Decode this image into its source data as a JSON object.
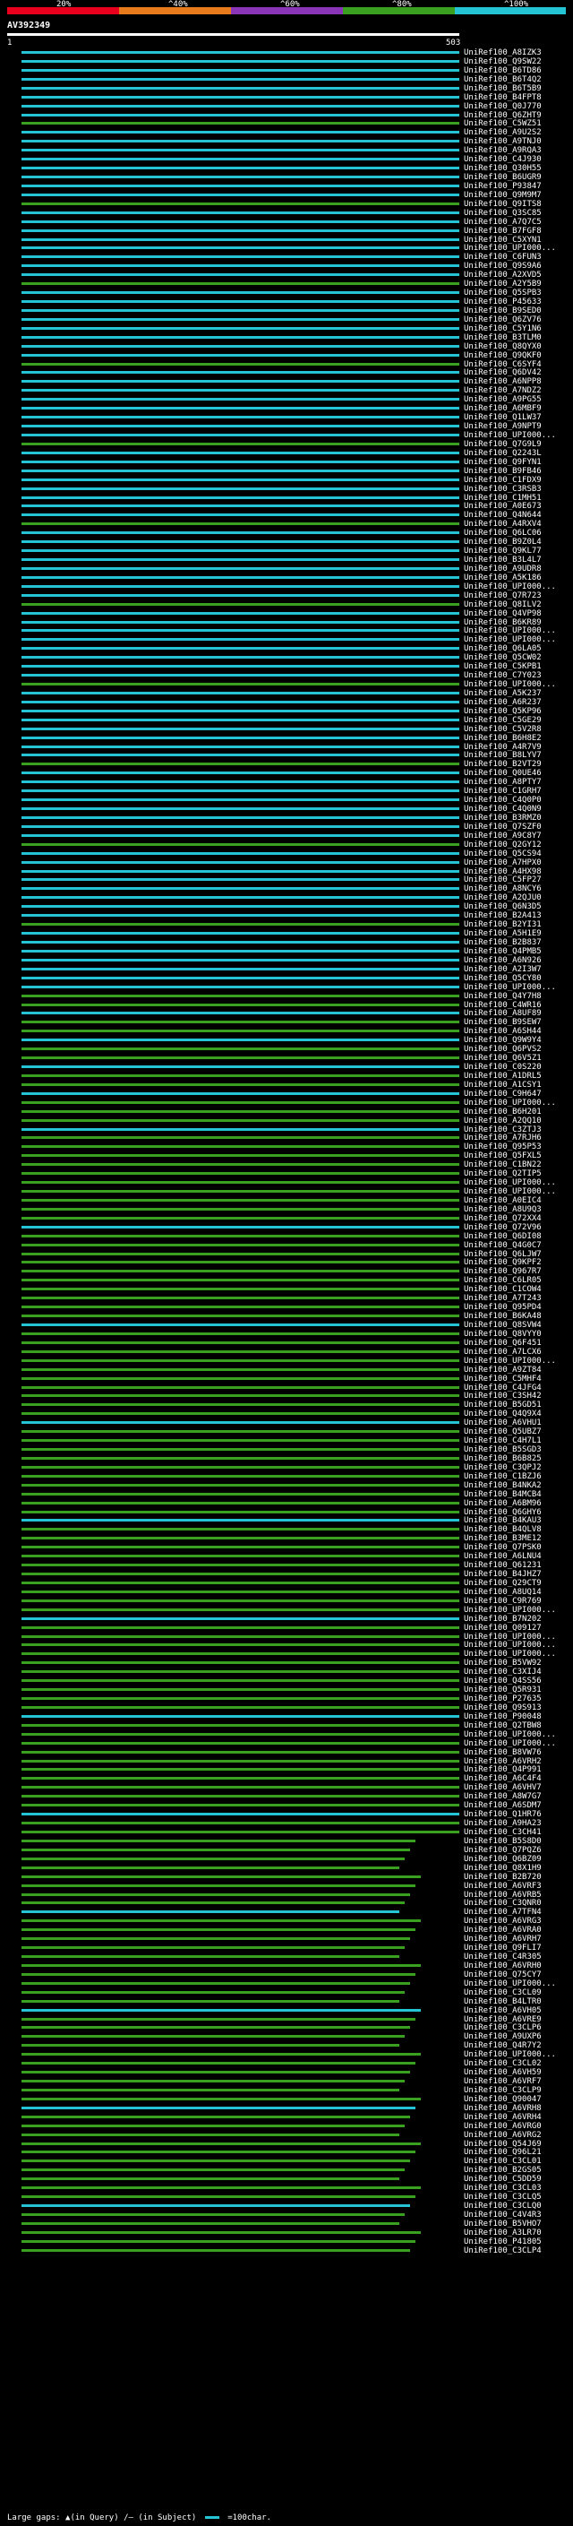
{
  "legend": {
    "labels": [
      "20%",
      "^40%",
      "^60%",
      "^80%",
      "^100%"
    ],
    "colors": [
      "#e8001c",
      "#e87b1c",
      "#8a35b8",
      "#3aa020",
      "#24c4d4"
    ]
  },
  "query": {
    "title": "AV392349",
    "start": "1",
    "end": "503"
  },
  "hit_labels": [
    "UniRef100_A8IZK3",
    "UniRef100_Q9SW22",
    "UniRef100_B6TD86",
    "UniRef100_B6T4Q2",
    "UniRef100_B6T5B9",
    "UniRef100_B4FPT8",
    "UniRef100_Q0J770",
    "UniRef100_Q6ZHT9",
    "UniRef100_C5WZ51",
    "UniRef100_A9U2S2",
    "UniRef100_A9TNJ0",
    "UniRef100_A9RQA3",
    "UniRef100_C4J930",
    "UniRef100_Q30H55",
    "UniRef100_B6UGR9",
    "UniRef100_P93847",
    "UniRef100_Q9M9M7",
    "UniRef100_Q9ITS8",
    "UniRef100_Q3SC85",
    "UniRef100_A7Q7C5",
    "UniRef100_B7FGF8",
    "UniRef100_C5XYN1",
    "UniRef100_UPI000...",
    "UniRef100_C6FUN3",
    "UniRef100_Q9S9A6",
    "UniRef100_A2XVD5",
    "UniRef100_A2Y5B9",
    "UniRef100_Q5SPB3",
    "UniRef100_P45633",
    "UniRef100_B9SED0",
    "UniRef100_Q6ZV76",
    "UniRef100_C5Y1N6",
    "UniRef100_B3TLM0",
    "UniRef100_Q8QYX0",
    "UniRef100_Q9QKF0",
    "UniRef100_C6SYF4",
    "UniRef100_Q6DV42",
    "UniRef100_A6NPP8",
    "UniRef100_A7NDZ2",
    "UniRef100_A9PG55",
    "UniRef100_A6MBF9",
    "UniRef100_Q1LW37",
    "UniRef100_A9NPT9",
    "UniRef100_UPI000...",
    "UniRef100_Q7G9L9",
    "UniRef100_Q2243L",
    "UniRef100_Q9FYN1",
    "UniRef100_B9FB46",
    "UniRef100_C1FDX9",
    "UniRef100_C3RSB3",
    "UniRef100_C1MH51",
    "UniRef100_A0E673",
    "UniRef100_Q4N644",
    "UniRef100_A4RXV4",
    "UniRef100_Q6LC06",
    "UniRef100_B9Z0L4",
    "UniRef100_Q9KL77",
    "UniRef100_B3L4L7",
    "UniRef100_A9UDR8",
    "UniRef100_A5K186",
    "UniRef100_UPI000...",
    "UniRef100_Q7R723",
    "UniRef100_Q8ILV2",
    "UniRef100_Q4VP98",
    "UniRef100_B6KR89",
    "UniRef100_UPI000...",
    "UniRef100_UPI000...",
    "UniRef100_Q6LA05",
    "UniRef100_Q5CW02",
    "UniRef100_C5KPB1",
    "UniRef100_C7Y023",
    "UniRef100_UPI000...",
    "UniRef100_A5K237",
    "UniRef100_A6R237",
    "UniRef100_Q5KP96",
    "UniRef100_C5GE29",
    "UniRef100_C5V2R8",
    "UniRef100_B6H8E2",
    "UniRef100_A4R7V9",
    "UniRef100_B8LYV7",
    "UniRef100_B2VT29",
    "UniRef100_Q0UE46",
    "UniRef100_A8PTY7",
    "UniRef100_C1GRH7",
    "UniRef100_C4Q0P0",
    "UniRef100_C4Q0N9",
    "UniRef100_B3RMZ0",
    "UniRef100_Q7SZF0",
    "UniRef100_A9C8Y7",
    "UniRef100_Q2GY12",
    "UniRef100_Q5CS94",
    "UniRef100_A7HPX0",
    "UniRef100_A4HX98",
    "UniRef100_C5FP27",
    "UniRef100_A8NCY6",
    "UniRef100_A2QJU0",
    "UniRef100_Q6N3D5",
    "UniRef100_B2A413",
    "UniRef100_B2YI31",
    "UniRef100_A5H1E9",
    "UniRef100_B2B837",
    "UniRef100_Q4PMB5",
    "UniRef100_A6N926",
    "UniRef100_A2I3W7",
    "UniRef100_Q5CY80",
    "UniRef100_UPI000...",
    "UniRef100_Q4Y7H8",
    "UniRef100_C4WR16",
    "UniRef100_A8UF89",
    "UniRef100_B9SEW7",
    "UniRef100_A6SH44",
    "UniRef100_Q9W9Y4",
    "UniRef100_Q6PVS2",
    "UniRef100_Q6V5Z1",
    "UniRef100_C0S220",
    "UniRef100_A1DRL5",
    "UniRef100_A1CSY1",
    "UniRef100_C9H647",
    "UniRef100_UPI000...",
    "UniRef100_B6H201",
    "UniRef100_A2QQ10",
    "UniRef100_C3ZTJ3",
    "UniRef100_A7RJH6",
    "UniRef100_Q95P53",
    "UniRef100_Q5FXL5",
    "UniRef100_C1BN22",
    "UniRef100_Q2TIP5",
    "UniRef100_UPI000...",
    "UniRef100_UPI000...",
    "UniRef100_A0EIC4",
    "UniRef100_A8U9Q3",
    "UniRef100_Q72XX4",
    "UniRef100_Q72V96",
    "UniRef100_Q6DI08",
    "UniRef100_Q4G0C7",
    "UniRef100_Q6LJW7",
    "UniRef100_Q9KPF2",
    "UniRef100_Q967R7",
    "UniRef100_C6LR05",
    "UniRef100_C1COW4",
    "UniRef100_A7T243",
    "UniRef100_Q95PD4",
    "UniRef100_B6KA48",
    "UniRef100_Q8SVW4",
    "UniRef100_Q8VYY0",
    "UniRef100_Q6F451",
    "UniRef100_A7LCX6",
    "UniRef100_UPI000...",
    "UniRef100_A9ZT84",
    "UniRef100_C5MHF4",
    "UniRef100_C4JFG4",
    "UniRef100_C3SH42",
    "UniRef100_B5GD51",
    "UniRef100_Q4Q9X4",
    "UniRef100_A6VHU1",
    "UniRef100_Q5UBZ7",
    "UniRef100_C4H7L1",
    "UniRef100_B5SGD3",
    "UniRef100_B6B825",
    "UniRef100_C3QPJ2",
    "UniRef100_C1BZJ6",
    "UniRef100_B4NKA2",
    "UniRef100_B4MCB4",
    "UniRef100_A6BM96",
    "UniRef100_Q6GHY6",
    "UniRef100_B4KAU3",
    "UniRef100_B4QLV8",
    "UniRef100_B3ME12",
    "UniRef100_Q7PSK0",
    "UniRef100_A6LNU4",
    "UniRef100_Q61231",
    "UniRef100_B4JHZ7",
    "UniRef100_Q29CT9",
    "UniRef100_A8UQ14",
    "UniRef100_C9R769",
    "UniRef100_UPI000...",
    "UniRef100_B7N202",
    "UniRef100_Q09127",
    "UniRef100_UPI000...",
    "UniRef100_UPI000...",
    "UniRef100_UPI000...",
    "UniRef100_B5VW92",
    "UniRef100_C3XIJ4",
    "UniRef100_Q4SS56",
    "UniRef100_Q5R931",
    "UniRef100_P27635",
    "UniRef100_Q9S913",
    "UniRef100_P90048",
    "UniRef100_Q2TBW8",
    "UniRef100_UPI000...",
    "UniRef100_UPI000...",
    "UniRef100_B8VW76",
    "UniRef100_A6VRH2",
    "UniRef100_Q4P991",
    "UniRef100_A6C4F4",
    "UniRef100_A6VHV7",
    "UniRef100_A8W7G7",
    "UniRef100_A6SDM7",
    "UniRef100_Q1HR76",
    "UniRef100_A9HA23",
    "UniRef100_C3CH41",
    "UniRef100_B5S8D0",
    "UniRef100_Q7PQZ6",
    "UniRef100_Q6BZ09",
    "UniRef100_Q8X1H9",
    "UniRef100_B2B720",
    "UniRef100_A6VRF3",
    "UniRef100_A6VRB5",
    "UniRef100_C3QNR0",
    "UniRef100_A7TFN4",
    "UniRef100_A6VRG3",
    "UniRef100_A6VRA0",
    "UniRef100_A6VRH7",
    "UniRef100_Q9FLI7",
    "UniRef100_C4R305",
    "UniRef100_A6VRH0",
    "UniRef100_Q75CY7",
    "UniRef100_UPI000...",
    "UniRef100_C3CL09",
    "UniRef100_B4LTR0",
    "UniRef100_A6VH05",
    "UniRef100_A6VRE9",
    "UniRef100_C3CLP6",
    "UniRef100_A9UXP6",
    "UniRef100_Q4R7Y2",
    "UniRef100_UPI000...",
    "UniRef100_C3CL02",
    "UniRef100_A6VH59",
    "UniRef100_A6VRF7",
    "UniRef100_C3CLP9",
    "UniRef100_Q90047",
    "UniRef100_A6VRH8",
    "UniRef100_A6VRH4",
    "UniRef100_A6VRG0",
    "UniRef100_A6VRG2",
    "UniRef100_Q54J69",
    "UniRef100_Q96L21",
    "UniRef100_C3CL01",
    "UniRef100_B2GS05",
    "UniRef100_C5DD59",
    "UniRef100_C3CL03",
    "UniRef100_C3CLQ5",
    "UniRef100_C3CLQ0",
    "UniRef100_C4V4R3",
    "UniRef100_B5VHO7",
    "UniRef100_A3LR70",
    "UniRef100_P41805",
    "UniRef100_C3CLP4"
  ],
  "footer": {
    "gaps_label": "Large gaps:",
    "gap_query": "▲(in Query)",
    "gap_subject": "/— (in Subject)",
    "scale_label": "=100char."
  }
}
